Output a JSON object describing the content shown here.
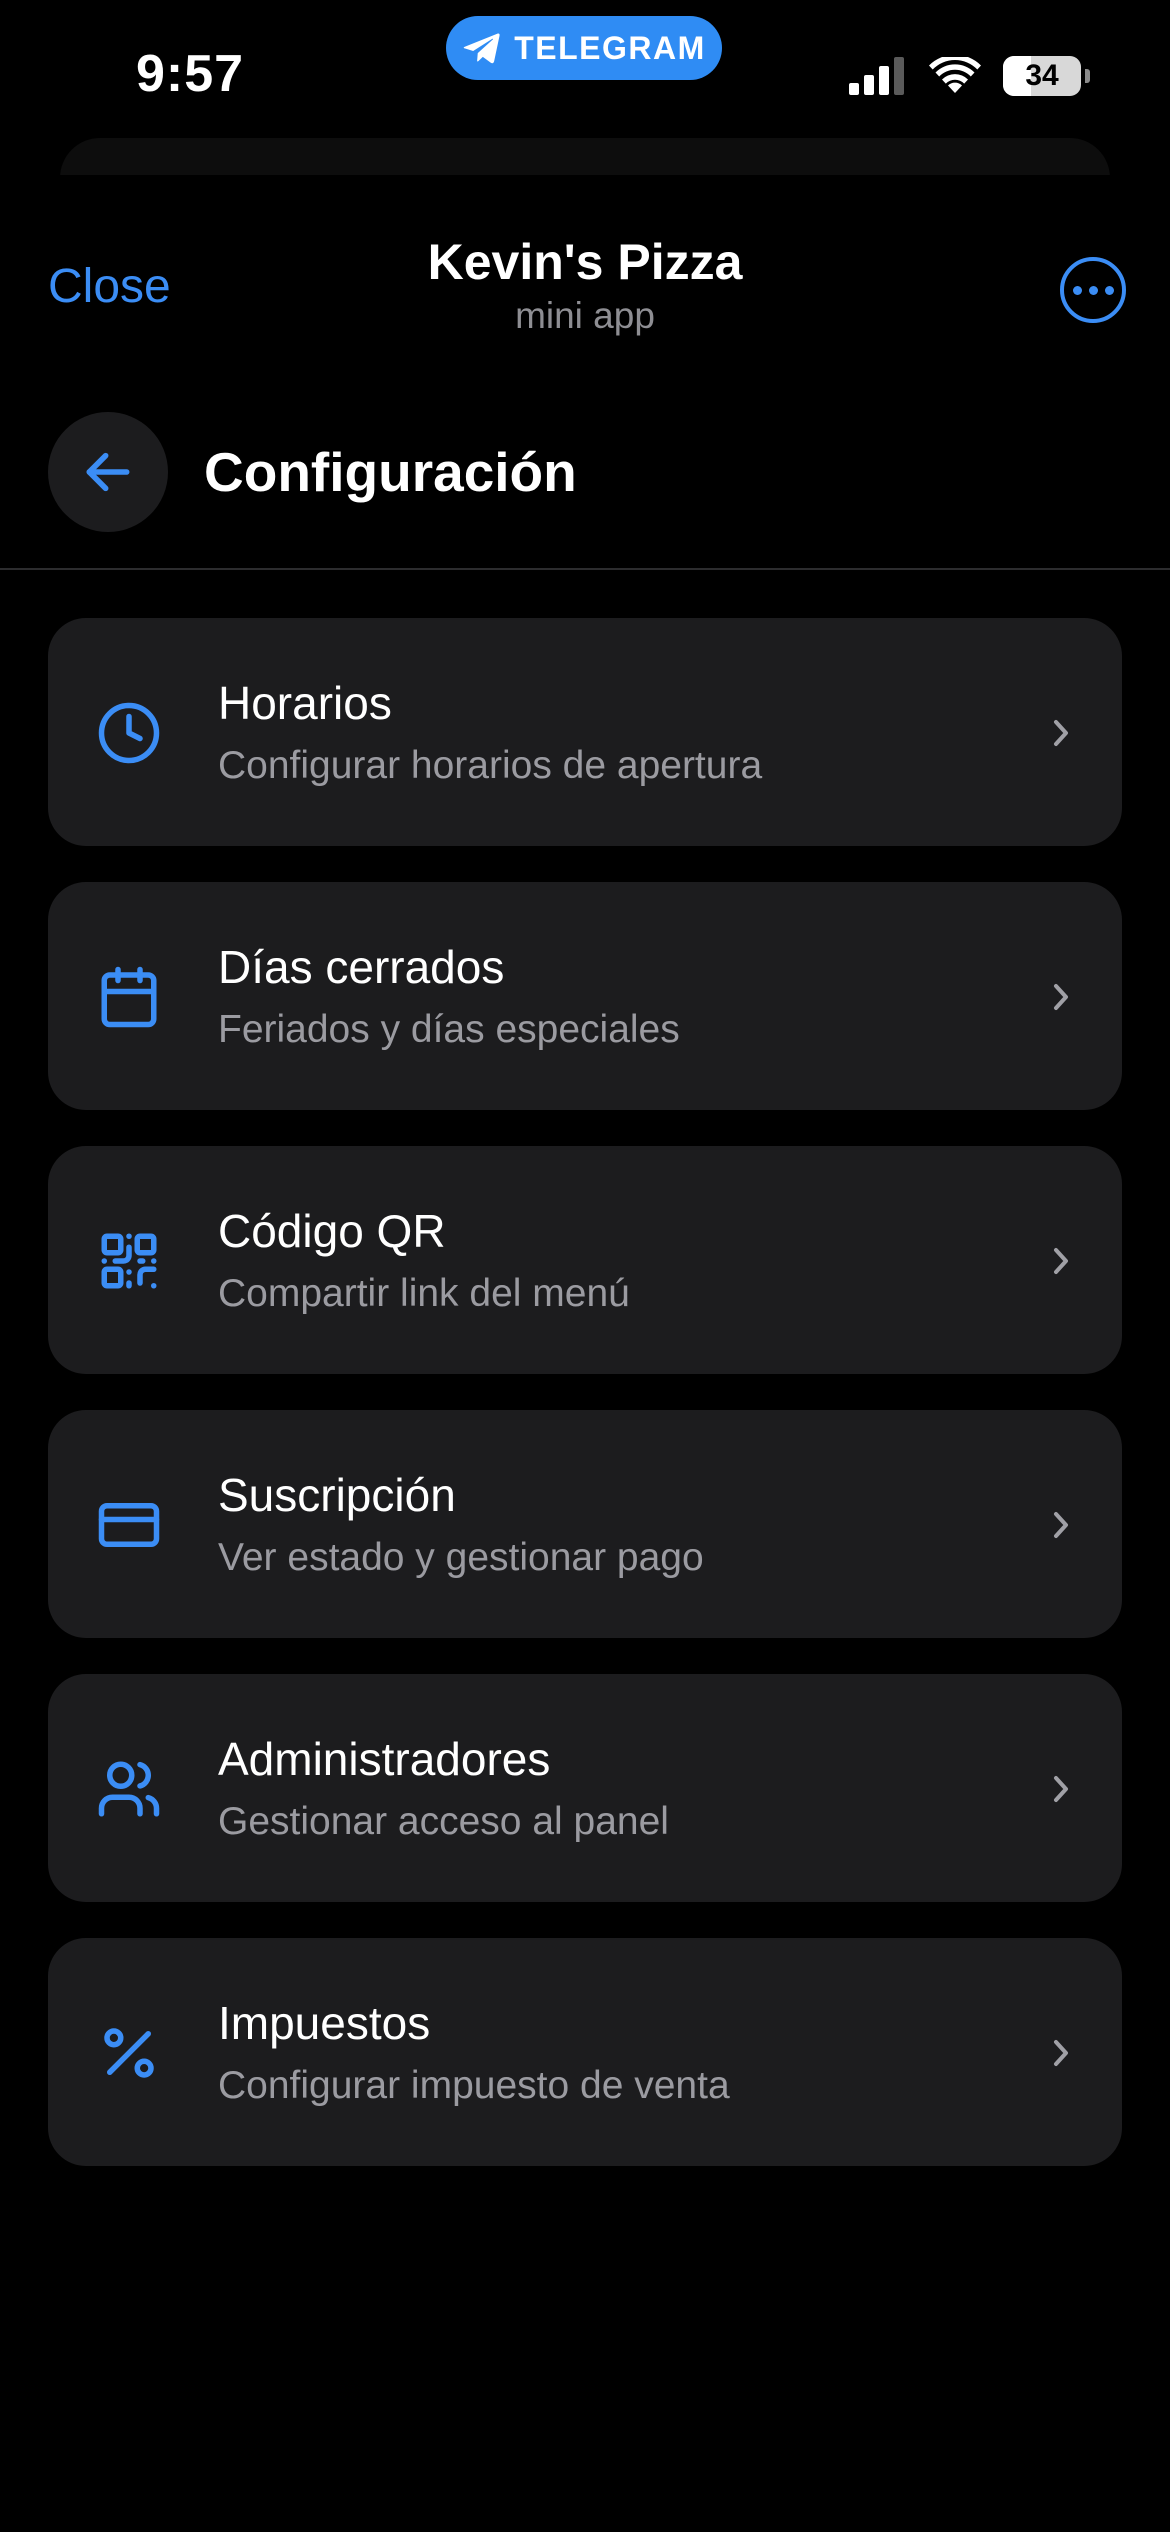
{
  "status_bar": {
    "time": "9:57",
    "telegram_label": "TELEGRAM",
    "battery": "34"
  },
  "header": {
    "close_label": "Close",
    "title": "Kevin's Pizza",
    "subtitle": "mini app"
  },
  "page": {
    "title": "Configuración"
  },
  "items": [
    {
      "icon": "clock-icon",
      "title": "Horarios",
      "subtitle": "Configurar horarios de apertura"
    },
    {
      "icon": "calendar-icon",
      "title": "Días cerrados",
      "subtitle": "Feriados y días especiales"
    },
    {
      "icon": "qr-code-icon",
      "title": "Código QR",
      "subtitle": "Compartir link del menú"
    },
    {
      "icon": "credit-card-icon",
      "title": "Suscripción",
      "subtitle": "Ver estado y gestionar pago"
    },
    {
      "icon": "users-icon",
      "title": "Administradores",
      "subtitle": "Gestionar acceso al panel"
    },
    {
      "icon": "percent-icon",
      "title": "Impuestos",
      "subtitle": "Configurar impuesto de venta"
    }
  ],
  "colors": {
    "accent": "#3b8df5",
    "telegram_blue": "#2f8cf4",
    "card_bg": "#1c1c1e",
    "subtitle_gray": "#9b9ba1"
  }
}
